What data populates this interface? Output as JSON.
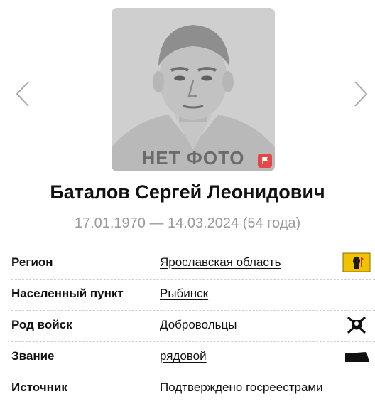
{
  "gallery": {
    "no_photo_label": "НЕТ ФОТО",
    "icons": {
      "prev": "chevron-left-icon",
      "next": "chevron-right-icon",
      "report": "flag-icon"
    },
    "badge_color": "#e64646"
  },
  "person": {
    "name": "Баталов Сергей Леонидович",
    "dates": "17.01.1970 — 14.03.2024 (54 года)"
  },
  "details": {
    "region": {
      "label": "Регион",
      "value": "Ярославская область",
      "icon": "yaroslavl-coat-of-arms-icon"
    },
    "settlement": {
      "label": "Населенный пункт",
      "value": "Рыбинск"
    },
    "branch": {
      "label": "Род войск",
      "value": "Добровольцы",
      "icon": "volunteers-emblem-icon"
    },
    "rank": {
      "label": "Звание",
      "value": "рядовой",
      "icon": "private-rank-insignia-icon"
    },
    "source": {
      "label": "Источник",
      "value": "Подтверждено госреестрами"
    }
  },
  "colors": {
    "text": "#111111",
    "muted": "#9a9a9a",
    "accent_yellow": "#f2c200",
    "badge_red": "#e64646"
  }
}
